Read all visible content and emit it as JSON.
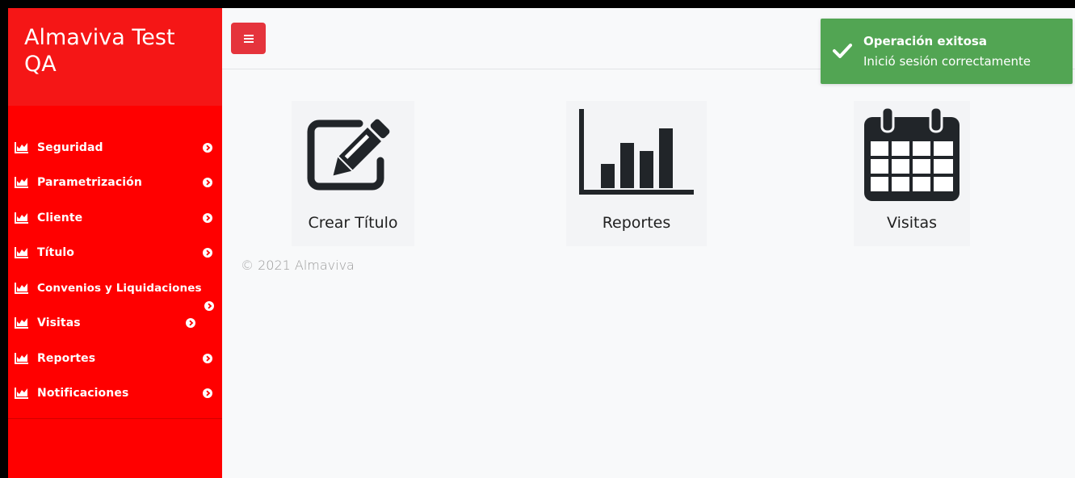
{
  "brand": {
    "title": "Almaviva Test QA"
  },
  "sidebar": {
    "items": [
      {
        "label": "Seguridad",
        "icon": "chart-area-icon"
      },
      {
        "label": "Parametrización",
        "icon": "chart-area-icon"
      },
      {
        "label": "Cliente",
        "icon": "chart-area-icon"
      },
      {
        "label": "Título",
        "icon": "chart-area-icon"
      },
      {
        "label": "Convenios y Liquidaciones",
        "icon": "chart-area-icon"
      },
      {
        "label": "Visitas",
        "icon": "chart-area-icon"
      },
      {
        "label": "Reportes",
        "icon": "chart-area-icon"
      },
      {
        "label": "Notificaciones",
        "icon": "chart-area-icon"
      }
    ]
  },
  "topbar": {
    "toggle_icon": "hamburger-icon"
  },
  "tiles": [
    {
      "label": "Crear Título",
      "icon": "edit-icon"
    },
    {
      "label": "Reportes",
      "icon": "bar-chart-icon"
    },
    {
      "label": "Visitas",
      "icon": "calendar-icon"
    }
  ],
  "footer": {
    "text": "© 2021 Almaviva"
  },
  "toast": {
    "title": "Operación exitosa",
    "message": "Inició sesión correctamente",
    "icon": "check-icon"
  },
  "colors": {
    "sidebar": "#ff0000",
    "brand": "#f51616",
    "toggle": "#e5343c",
    "toast": "#52a553",
    "icon": "#212529"
  }
}
